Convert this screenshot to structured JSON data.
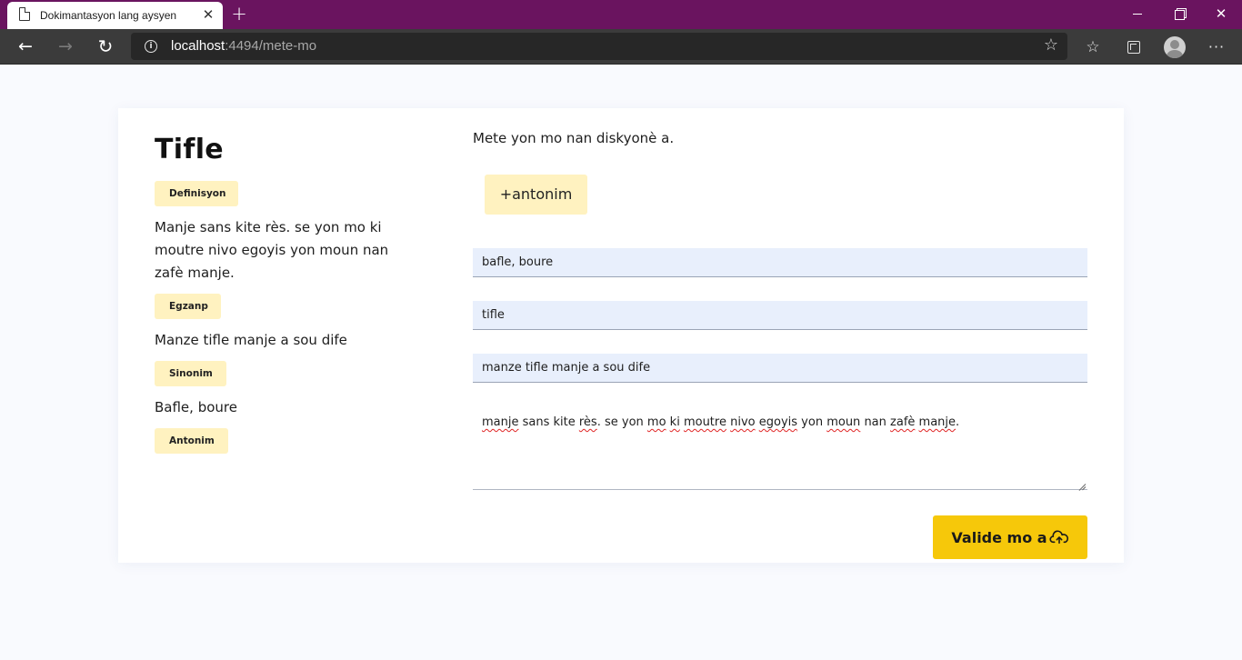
{
  "browser": {
    "tab_title": "Dokimantasyon lang aysyen",
    "url_host": "localhost",
    "url_rest": ":4494/mete-mo"
  },
  "page": {
    "word": "Tifle",
    "definition_label": "Definisyon",
    "definition_text": "Manje sans kite rès. se yon mo ki moutre nivo egoyis yon moun nan zafè manje.",
    "example_label": "Egzanp",
    "example_text": "Manze tifle manje a sou dife",
    "synonym_label": "Sinonim",
    "synonym_text": "Bafle, boure",
    "antonym_label": "Antonim"
  },
  "form": {
    "prompt": "Mete yon mo nan diskyonè a.",
    "add_antonym_label": "+antonim",
    "synonyms_value": "bafle, boure",
    "word_value": "tifle",
    "example_value": "manze tifle manje a sou dife",
    "definition_words": [
      "manje",
      " sans kite ",
      "rès",
      ". se yon ",
      "mo",
      " ",
      "ki",
      " ",
      "moutre",
      " ",
      "nivo",
      " ",
      "egoyis",
      " yon ",
      "moun",
      " nan ",
      "zafè",
      " ",
      "manje",
      "."
    ],
    "submit_label": "Valide mo a"
  },
  "colors": {
    "titlebar": "#6a145f",
    "chip": "#fff2c0",
    "submit": "#f6c80a",
    "field_bg": "#e8effc"
  }
}
